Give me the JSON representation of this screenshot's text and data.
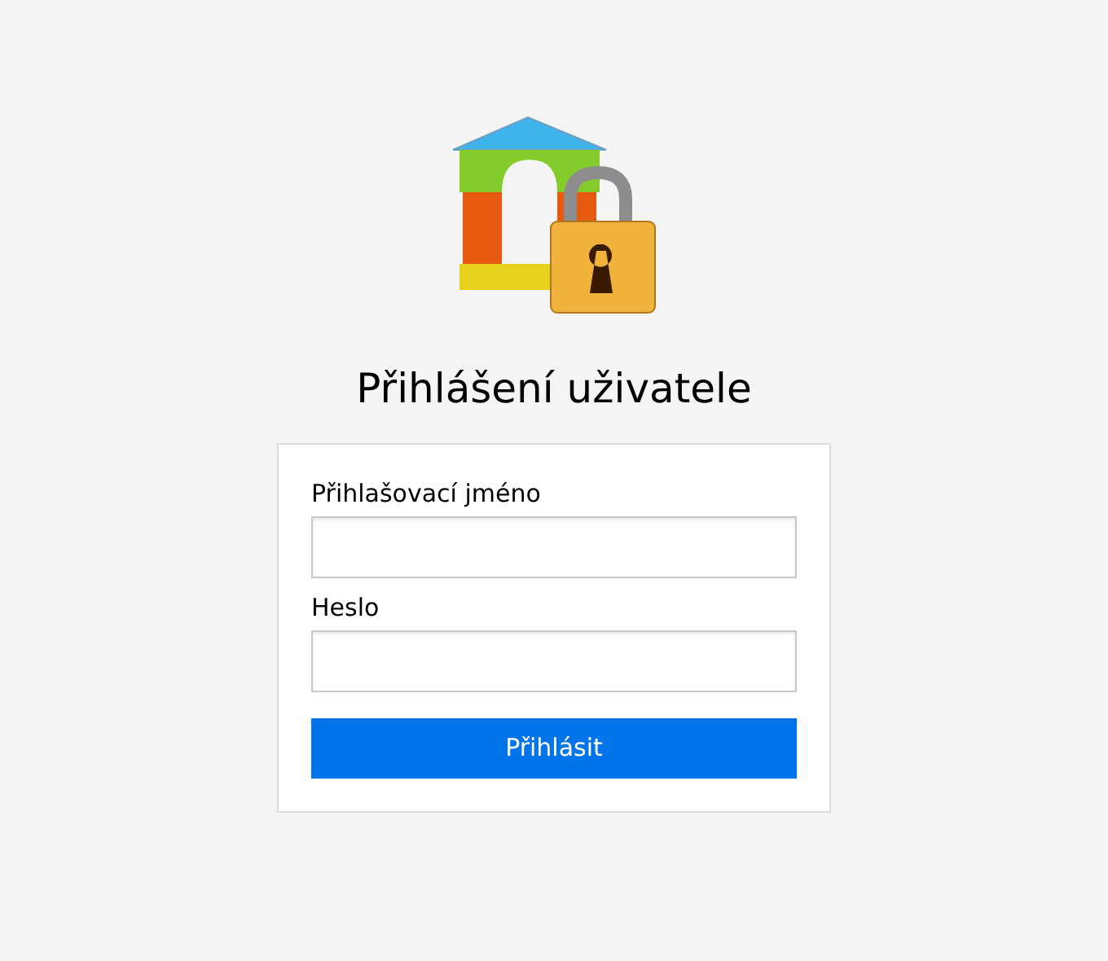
{
  "title": "Přihlášení uživatele",
  "fields": [
    {
      "label": "Přihlašovací jméno"
    },
    {
      "label": "Heslo"
    }
  ],
  "button": "Přihlásit"
}
